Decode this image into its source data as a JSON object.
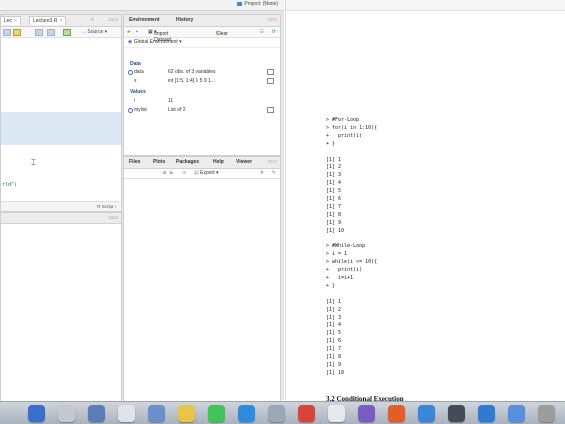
{
  "rstudio": {
    "project_label": "Project: (None)",
    "source": {
      "tabs": [
        {
          "label": "Lec"
        },
        {
          "label": "Lecture3.R"
        }
      ],
      "source_button": "Source",
      "code_lines": [
        "",
        "rld\")"
      ],
      "script_type": "R Script"
    },
    "environment": {
      "tabs": [
        "Environment",
        "History"
      ],
      "import_dataset": "Import Dataset",
      "clear": "Clear",
      "scope": "Global Environment",
      "data_header": "Data",
      "data_rows": [
        {
          "name": "data",
          "value": "62 obs. of 3 variables"
        },
        {
          "name": "x",
          "value": "int [1:5, 1:4] 1 5 9 1..."
        }
      ],
      "values_header": "Values",
      "value_rows": [
        {
          "name": "i",
          "value": "11"
        },
        {
          "name": "mylist",
          "value": "List of 2"
        }
      ]
    },
    "files": {
      "tabs": [
        "Files",
        "Plots",
        "Packages",
        "Help",
        "Viewer"
      ],
      "export": "Export"
    }
  },
  "pdf": {
    "lines": [
      "> #For-Loop",
      "> for(i in 1:10){",
      "+   print(i)",
      "+ }",
      "",
      "[1] 1",
      "[1] 2",
      "[1] 3",
      "[1] 4",
      "[1] 5",
      "[1] 6",
      "[1] 7",
      "[1] 8",
      "[1] 9",
      "[1] 10",
      "",
      "> #While-Loop",
      "> i = 1",
      "> while(i <= 10){",
      "+   print(i)",
      "+   i=i+1",
      "+ }",
      "",
      "[1] 1",
      "[1] 2",
      "[1] 3",
      "[1] 4",
      "[1] 5",
      "[1] 6",
      "[1] 7",
      "[1] 8",
      "[1] 9",
      "[1] 10"
    ],
    "section_title": "3.2   Conditional Execution"
  },
  "dock": {
    "colors": [
      "#3a6fc9",
      "#c4c8cf",
      "#5a7fb8",
      "#e0e4ea",
      "#6b8fcc",
      "#e8c547",
      "#3ec457",
      "#2c8de0",
      "#9aa7b6",
      "#d8433a",
      "#e7e9ec",
      "#7a5cc2",
      "#e25d27",
      "#3a86d8",
      "#444b55",
      "#2f7bd2",
      "#5a8ee0",
      "#9c9c9c"
    ]
  }
}
